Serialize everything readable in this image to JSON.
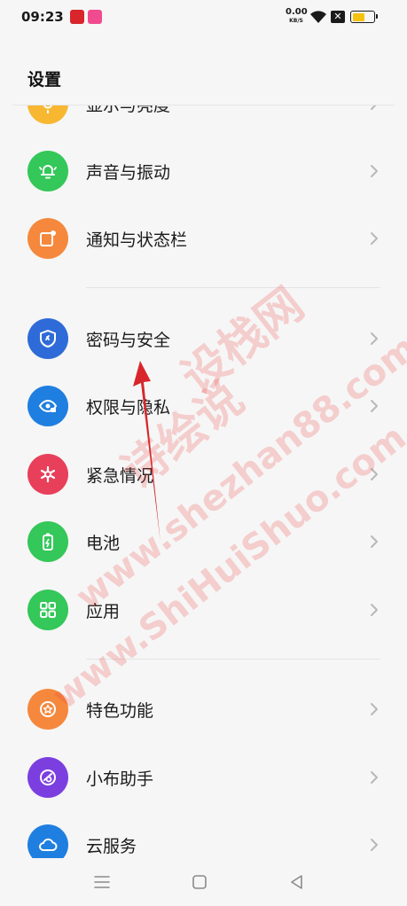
{
  "status": {
    "time": "09:23",
    "net_speed": "0.00",
    "net_unit": "KB/S",
    "battery_level": 0.6
  },
  "page": {
    "title": "设置"
  },
  "items": [
    {
      "label": "显示与亮度",
      "icon": "sun-icon",
      "color": "#f7b731"
    },
    {
      "label": "声音与振动",
      "icon": "bell-icon",
      "color": "#34c759"
    },
    {
      "label": "通知与状态栏",
      "icon": "notification-icon",
      "color": "#f5883c"
    },
    {
      "label": "密码与安全",
      "icon": "shield-icon",
      "color": "#2f6bd8"
    },
    {
      "label": "权限与隐私",
      "icon": "eye-lock-icon",
      "color": "#1f7fe0"
    },
    {
      "label": "紧急情况",
      "icon": "asterisk-icon",
      "color": "#e8405a"
    },
    {
      "label": "电池",
      "icon": "battery-icon",
      "color": "#34c759"
    },
    {
      "label": "应用",
      "icon": "grid-icon",
      "color": "#34c759"
    },
    {
      "label": "特色功能",
      "icon": "star-badge-icon",
      "color": "#f5883c"
    },
    {
      "label": "小布助手",
      "icon": "assistant-icon",
      "color": "#7b3fe0"
    },
    {
      "label": "云服务",
      "icon": "cloud-icon",
      "color": "#1f7fe0"
    }
  ],
  "watermark": {
    "line1": "设栈网",
    "line2": "诗绘说",
    "line3": "www.shezhan88.com",
    "line4": "www.ShiHuiShuo.com"
  }
}
